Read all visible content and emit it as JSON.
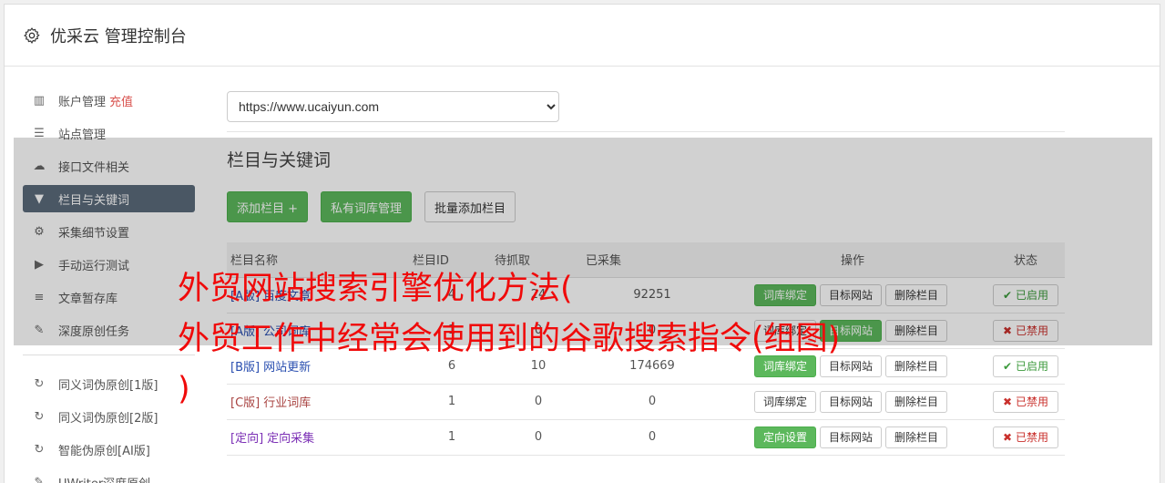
{
  "header": {
    "title": "优采云 管理控制台",
    "icon": "gear-icon"
  },
  "sidebar": {
    "items": [
      {
        "label": "账户管理",
        "extra": "充值",
        "icon": "bar-chart-icon"
      },
      {
        "label": "站点管理",
        "icon": "server-icon"
      },
      {
        "label": "接口文件相关",
        "icon": "cloud-upload-icon"
      },
      {
        "label": "栏目与关键词",
        "icon": "filter-icon",
        "active": true
      },
      {
        "label": "采集细节设置",
        "icon": "cogs-icon"
      },
      {
        "label": "手动运行测试",
        "icon": "play-circle-icon"
      },
      {
        "label": "文章暂存库",
        "icon": "database-icon"
      },
      {
        "label": "深度原创任务",
        "icon": "edit-icon"
      }
    ],
    "tools": [
      {
        "label": "同义词伪原创[1版]",
        "icon": "refresh-icon"
      },
      {
        "label": "同义词伪原创[2版]",
        "icon": "refresh-icon"
      },
      {
        "label": "智能伪原创[AI版]",
        "icon": "refresh-icon"
      },
      {
        "label": "UWriter深度原创",
        "icon": "edit-icon"
      }
    ]
  },
  "main": {
    "site_select": "https://www.ucaiyun.com",
    "section_title": "栏目与关键词",
    "buttons": {
      "add": "添加栏目 +",
      "private": "私有词库管理",
      "batch": "批量添加栏目"
    },
    "table": {
      "headers": [
        "栏目名称",
        "栏目ID",
        "待抓取",
        "已采集",
        "操作",
        "状态"
      ],
      "rows": [
        {
          "tag": "[A版]",
          "name": "百度文章",
          "id": "4",
          "pending": "24",
          "collected": "92251",
          "bind": "词库绑定",
          "bind_green": true,
          "target": "目标网站",
          "del": "删除栏目",
          "status": "已启用",
          "on": true
        },
        {
          "tag": "[A版]",
          "name": "公司词库",
          "id": "1",
          "pending": "0",
          "collected": "0",
          "bind": "词库绑定",
          "bind_green": false,
          "target": "目标网站",
          "del": "删除栏目",
          "status": "已禁用",
          "on": false
        },
        {
          "tag": "[B版]",
          "name": "网站更新",
          "id": "6",
          "pending": "10",
          "collected": "174669",
          "bind": "词库绑定",
          "bind_green": true,
          "target": "目标网站",
          "del": "删除栏目",
          "status": "已启用",
          "on": true
        },
        {
          "tag": "[C版]",
          "name": "行业词库",
          "id": "1",
          "pending": "0",
          "collected": "0",
          "bind": "词库绑定",
          "bind_green": false,
          "target": "目标网站",
          "del": "删除栏目",
          "status": "已禁用",
          "on": false
        },
        {
          "tag": "[定向]",
          "name": "定向采集",
          "id": "1",
          "pending": "0",
          "collected": "0",
          "bind": "定向设置",
          "bind_green": true,
          "target": "目标网站",
          "del": "删除栏目",
          "status": "已禁用",
          "on": false
        }
      ]
    }
  },
  "overlay_headline": {
    "line1": "外贸网站搜索引擎优化方法(",
    "line2": "外贸工作中经常会使用到的谷歌搜索指令(组图)",
    "line3": ")"
  },
  "colors": {
    "accent_green": "#5cb85c",
    "sidebar_active": "#5b6b7b",
    "headline_red": "#f00a0a"
  }
}
